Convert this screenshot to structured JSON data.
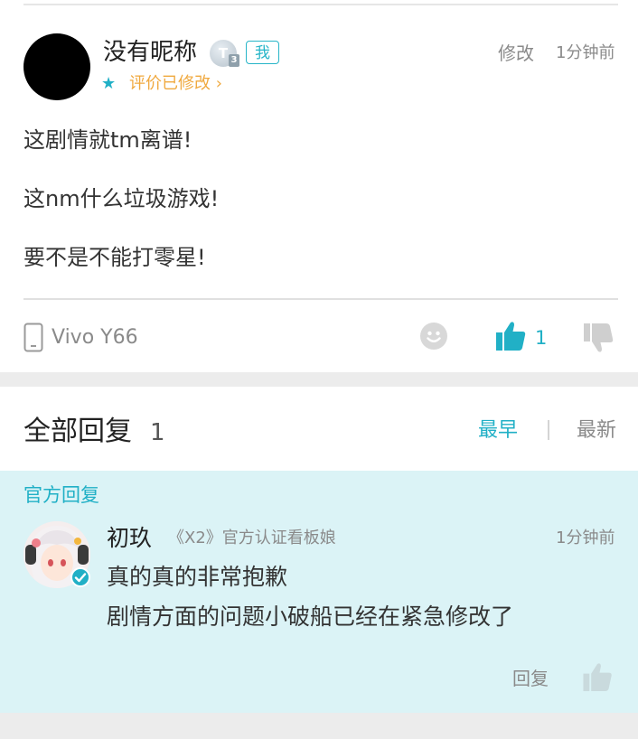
{
  "review": {
    "username": "没有昵称",
    "level_badge": "T",
    "level_sub": "3",
    "me_tag": "我",
    "edited_label": "评价已修改 ›",
    "edit_button": "修改",
    "time": "1分钟前",
    "lines": [
      "这剧情就tm离谱!",
      "这nm什么垃圾游戏!",
      "要不是不能打零星!"
    ],
    "device": "Vivo Y66",
    "like_count": "1"
  },
  "replies": {
    "title": "全部回复",
    "count": "1",
    "sort_early": "最早",
    "sort_new": "最新"
  },
  "official_reply": {
    "label": "官方回复",
    "name": "初玖",
    "tag": "《X2》官方认证看板娘",
    "time": "1分钟前",
    "lines": [
      "真的真的非常抱歉",
      "剧情方面的问题小破船已经在紧急修改了"
    ],
    "reply_button": "回复"
  },
  "colors": {
    "accent": "#21b0c6",
    "edited": "#f0a93f",
    "official_bg": "#dbf3f6",
    "band": "#ececec"
  }
}
